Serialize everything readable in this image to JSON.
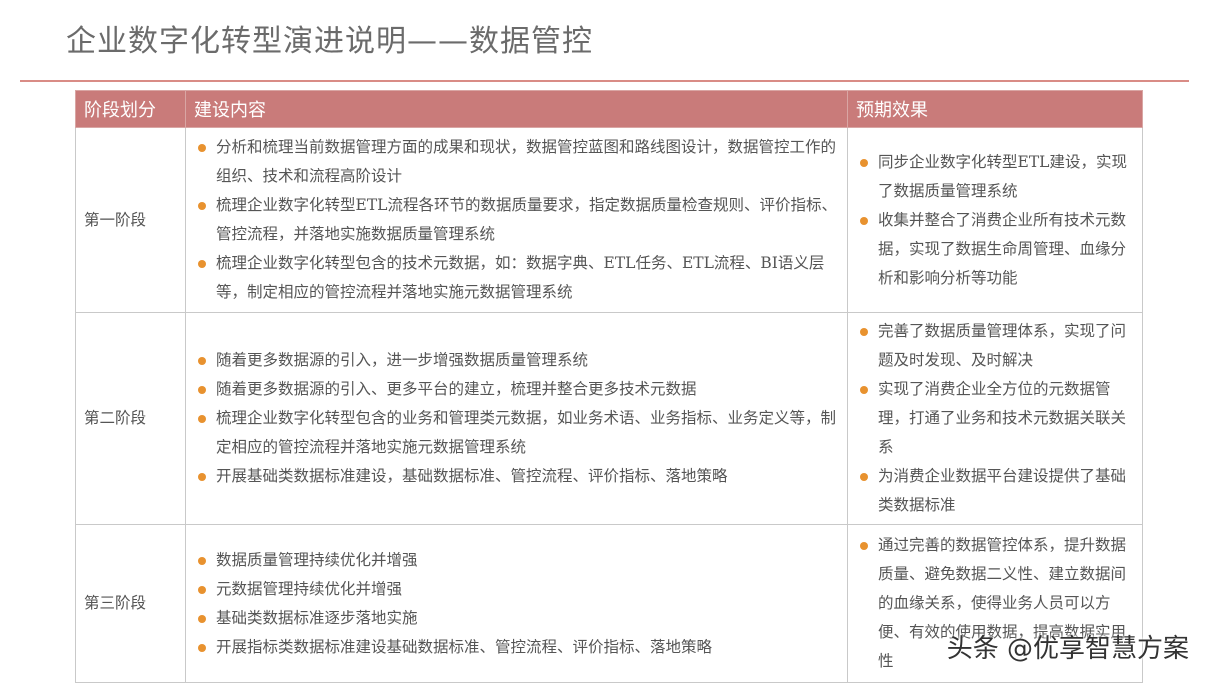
{
  "title": "企业数字化转型演进说明——数据管控",
  "table": {
    "headers": [
      "阶段划分",
      "建设内容",
      "预期效果"
    ],
    "rows": [
      {
        "stage": "第一阶段",
        "content": [
          "分析和梳理当前数据管理方面的成果和现状，数据管控蓝图和路线图设计，数据管控工作的组织、技术和流程高阶设计",
          "梳理企业数字化转型ETL流程各环节的数据质量要求，指定数据质量检查规则、评价指标、管控流程，并落地实施数据质量管理系统",
          "梳理企业数字化转型包含的技术元数据，如：数据字典、ETL任务、ETL流程、BI语义层等，制定相应的管控流程并落地实施元数据管理系统"
        ],
        "effect": [
          "同步企业数字化转型ETL建设，实现了数据质量管理系统",
          "收集并整合了消费企业所有技术元数据，实现了数据生命周管理、血缘分析和影响分析等功能"
        ]
      },
      {
        "stage": "第二阶段",
        "content": [
          "随着更多数据源的引入，进一步增强数据质量管理系统",
          "随着更多数据源的引入、更多平台的建立，梳理并整合更多技术元数据",
          "梳理企业数字化转型包含的业务和管理类元数据，如业务术语、业务指标、业务定义等，制定相应的管控流程并落地实施元数据管理系统",
          "开展基础类数据标准建设，基础数据标准、管控流程、评价指标、落地策略"
        ],
        "effect": [
          "完善了数据质量管理体系，实现了问题及时发现、及时解决",
          "实现了消费企业全方位的元数据管理，打通了业务和技术元数据关联关系",
          "为消费企业数据平台建设提供了基础类数据标准"
        ]
      },
      {
        "stage": "第三阶段",
        "content": [
          "数据质量管理持续优化并增强",
          "元数据管理持续优化并增强",
          "基础类数据标准逐步落地实施",
          "开展指标类数据标准建设基础数据标准、管控流程、评价指标、落地策略"
        ],
        "effect": [
          "通过完善的数据管控体系，提升数据质量、避免数据二义性、建立数据间的血缘关系，使得业务人员可以方便、有效的使用数据，提高数据实用性"
        ]
      }
    ]
  },
  "watermark": "头条 @优享智慧方案",
  "colors": {
    "header_bg": "#c97b7a",
    "title_rule": "#d98c86",
    "bullet": "#e8922f"
  }
}
